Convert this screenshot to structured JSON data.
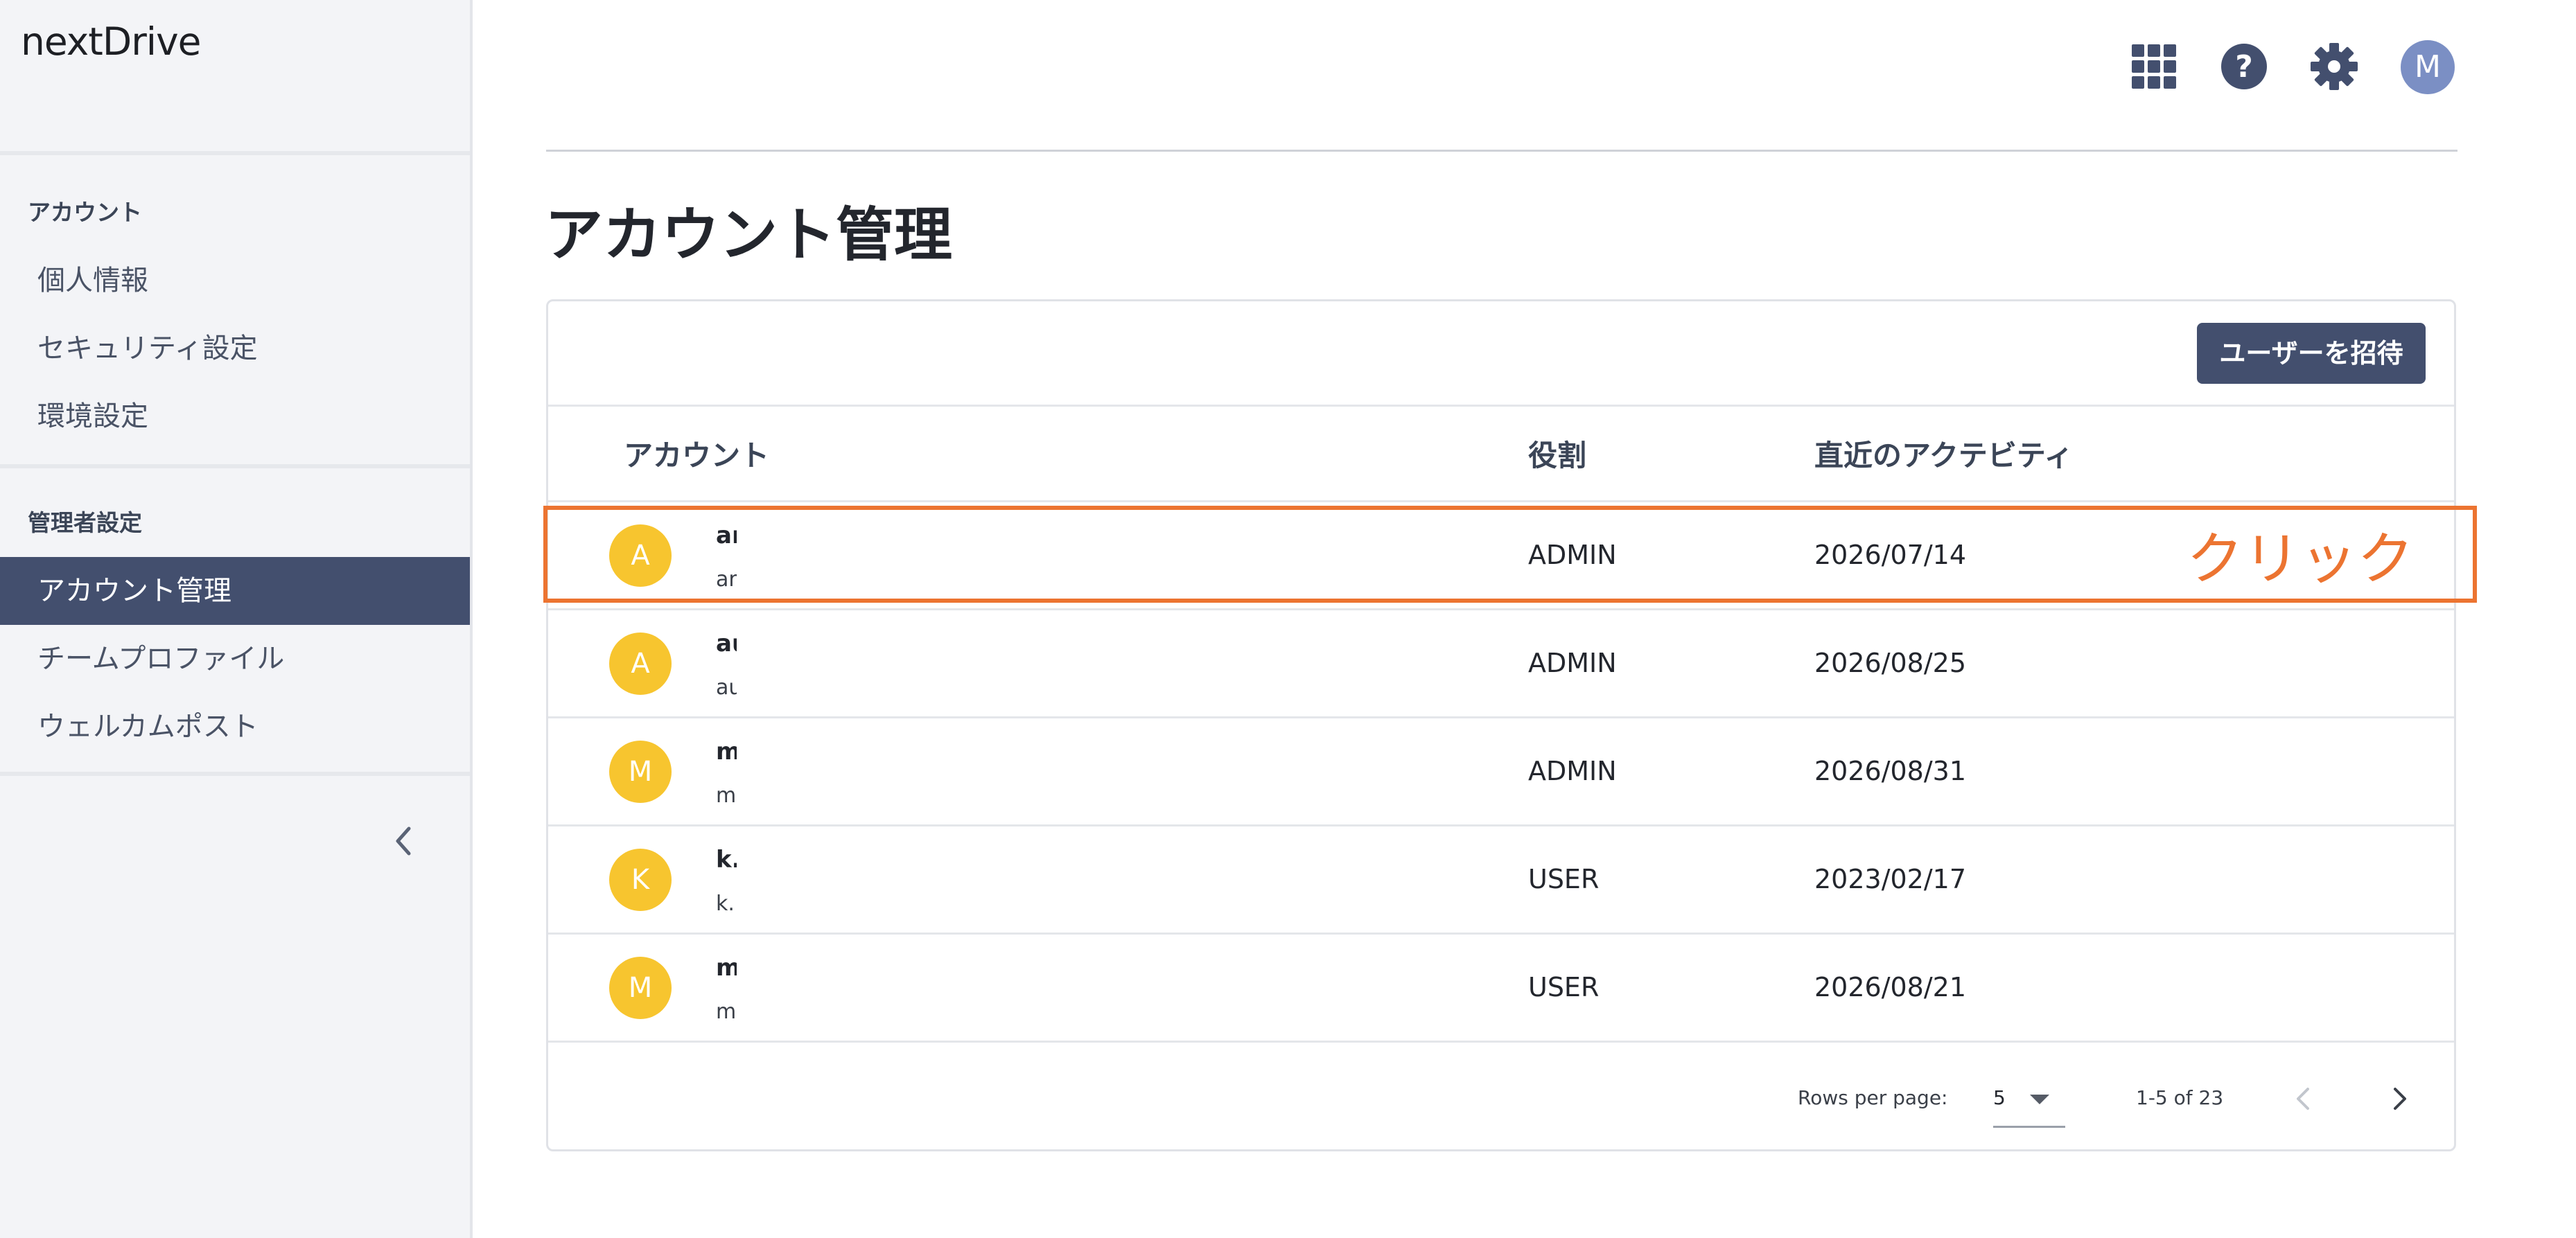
{
  "app": {
    "logo": "nextDrive"
  },
  "sidebar": {
    "section_account": "アカウント",
    "account_items": [
      {
        "label": "個人情報"
      },
      {
        "label": "セキュリティ設定"
      },
      {
        "label": "環境設定"
      }
    ],
    "section_admin": "管理者設定",
    "admin_items": [
      {
        "label": "アカウント管理",
        "active": true
      },
      {
        "label": "チームプロファイル"
      },
      {
        "label": "ウェルカムポスト"
      }
    ],
    "collapse_icon": "chevron-left-icon"
  },
  "topbar": {
    "icons": [
      "apps-grid-icon",
      "help-icon",
      "gear-icon"
    ],
    "avatar_initial": "M"
  },
  "main": {
    "title": "アカウント管理",
    "invite_button": "ユーザーを招待",
    "table": {
      "headers": {
        "account": "アカウント",
        "role": "役割",
        "activity": "直近のアクテビティ"
      },
      "rows": [
        {
          "initial": "A",
          "name": "ar",
          "email": "ar",
          "role": "ADMIN",
          "date": "2026/07/14"
        },
        {
          "initial": "A",
          "name": "au",
          "email": "au",
          "role": "ADMIN",
          "date": "2026/08/25"
        },
        {
          "initial": "M",
          "name": "m",
          "email": "m",
          "role": "ADMIN",
          "date": "2026/08/31"
        },
        {
          "initial": "K",
          "name": "k.",
          "email": "k.",
          "role": "USER",
          "date": "2023/02/17"
        },
        {
          "initial": "M",
          "name": "m",
          "email": "m",
          "role": "USER",
          "date": "2026/08/21"
        }
      ]
    },
    "pagination": {
      "rows_per_page_label": "Rows per page:",
      "rows_per_page_value": "5",
      "range": "1-5 of 23"
    }
  },
  "annotation": {
    "click_label": "クリック",
    "color": "#ec7431"
  },
  "colors": {
    "sidebar_active": "#434f6e",
    "avatar_row": "#f7c52f",
    "avatar_top": "#7b8fc4"
  }
}
